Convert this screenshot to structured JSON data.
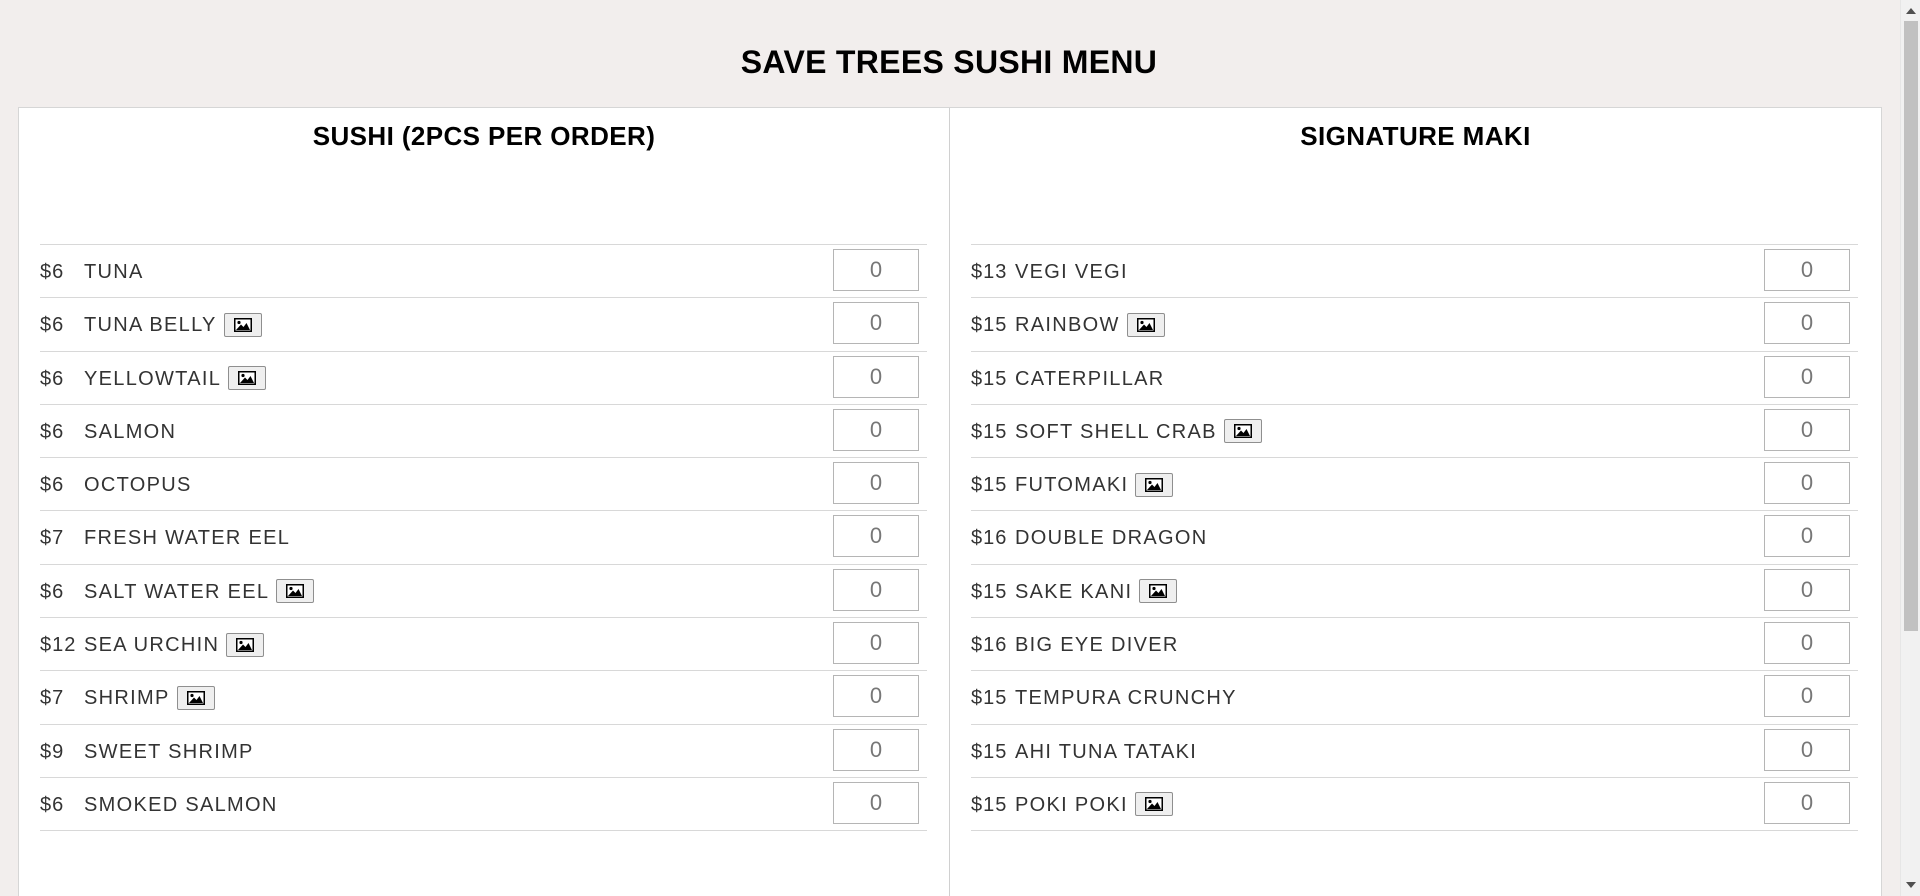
{
  "page": {
    "title": "SAVE TREES SUSHI MENU"
  },
  "sections": [
    {
      "title": "SUSHI (2PCS PER ORDER)",
      "items": [
        {
          "price": "$6",
          "name": "TUNA",
          "has_image": false,
          "qty": "0"
        },
        {
          "price": "$6",
          "name": "TUNA BELLY",
          "has_image": true,
          "qty": "0"
        },
        {
          "price": "$6",
          "name": "YELLOWTAIL",
          "has_image": true,
          "qty": "0"
        },
        {
          "price": "$6",
          "name": "SALMON",
          "has_image": false,
          "qty": "0"
        },
        {
          "price": "$6",
          "name": "OCTOPUS",
          "has_image": false,
          "qty": "0"
        },
        {
          "price": "$7",
          "name": "FRESH WATER EEL",
          "has_image": false,
          "qty": "0"
        },
        {
          "price": "$6",
          "name": "SALT WATER EEL",
          "has_image": true,
          "qty": "0"
        },
        {
          "price": "$12",
          "name": "SEA URCHIN",
          "has_image": true,
          "qty": "0"
        },
        {
          "price": "$7",
          "name": "SHRIMP",
          "has_image": true,
          "qty": "0"
        },
        {
          "price": "$9",
          "name": "SWEET SHRIMP",
          "has_image": false,
          "qty": "0"
        },
        {
          "price": "$6",
          "name": "SMOKED SALMON",
          "has_image": false,
          "qty": "0"
        }
      ]
    },
    {
      "title": "SIGNATURE MAKI",
      "items": [
        {
          "price": "$13",
          "name": "VEGI VEGI",
          "has_image": false,
          "qty": "0"
        },
        {
          "price": "$15",
          "name": "RAINBOW",
          "has_image": true,
          "qty": "0"
        },
        {
          "price": "$15",
          "name": "CATERPILLAR",
          "has_image": false,
          "qty": "0"
        },
        {
          "price": "$15",
          "name": "SOFT SHELL CRAB",
          "has_image": true,
          "qty": "0"
        },
        {
          "price": "$15",
          "name": "FUTOMAKI",
          "has_image": true,
          "qty": "0"
        },
        {
          "price": "$16",
          "name": "DOUBLE DRAGON",
          "has_image": false,
          "qty": "0"
        },
        {
          "price": "$15",
          "name": "SAKE KANI",
          "has_image": true,
          "qty": "0"
        },
        {
          "price": "$16",
          "name": "BIG EYE DIVER",
          "has_image": false,
          "qty": "0"
        },
        {
          "price": "$15",
          "name": "TEMPURA CRUNCHY",
          "has_image": false,
          "qty": "0"
        },
        {
          "price": "$15",
          "name": "AHI TUNA TATAKI",
          "has_image": false,
          "qty": "0"
        },
        {
          "price": "$15",
          "name": "POKI POKI",
          "has_image": true,
          "qty": "0"
        }
      ]
    }
  ],
  "icons": {
    "image_button": "image-icon"
  },
  "colors": {
    "page_background": "#f2eeed",
    "panel_background": "#ffffff",
    "text": "#333333",
    "divider": "#d8d8d8"
  }
}
